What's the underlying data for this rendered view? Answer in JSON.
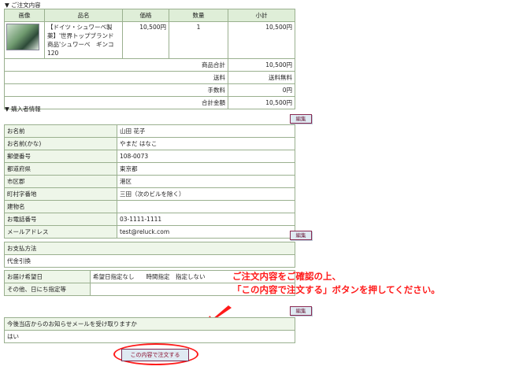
{
  "order": {
    "section_title": "▼ ご注文内容",
    "headers": [
      "画像",
      "品名",
      "価格",
      "数量",
      "小計"
    ],
    "item": {
      "name": "【ドイツ・シュワーベ製薬】'世界トップブランド商品'シュワーベ　ギンコ120",
      "price": "10,500円",
      "qty": "1",
      "subtotal": "10,500円"
    },
    "totals": [
      {
        "label": "商品合計",
        "value": "10,500円"
      },
      {
        "label": "送料",
        "value": "送料無料"
      },
      {
        "label": "手数料",
        "value": "0円"
      },
      {
        "label": "合計金額",
        "value": "10,500円"
      }
    ]
  },
  "buyer": {
    "section_title": "▼ 購入者情報",
    "edit_label": "編集",
    "rows": [
      {
        "label": "お名前",
        "value": "山田 花子"
      },
      {
        "label": "お名前(かな)",
        "value": "やまだ はなこ"
      },
      {
        "label": "郵便番号",
        "value": "108-0073"
      },
      {
        "label": "都道府県",
        "value": "東京都"
      },
      {
        "label": "市区郡",
        "value": "港区"
      },
      {
        "label": "町村字番地",
        "value": "三田（次のビルを除く）"
      },
      {
        "label": "建物名",
        "value": ""
      },
      {
        "label": "お電話番号",
        "value": "03-1111-1111"
      },
      {
        "label": "メールアドレス",
        "value": "test@reluck.com"
      }
    ]
  },
  "payment": {
    "edit_label": "編集",
    "label": "お支払方法",
    "value": "代金引換"
  },
  "delivery": {
    "rows": [
      {
        "label": "お届け希望日",
        "value": "希望日指定なし　　時間指定　指定しない"
      },
      {
        "label": "その他、日にち指定等",
        "value": ""
      }
    ]
  },
  "note": {
    "line1": "ご注文内容をご確認の上、",
    "line2": "「この内容で注文する」ボタンを押してください。"
  },
  "newsletter": {
    "edit_label": "編集",
    "label": "今後当店からのお知らせメールを受け取りますか",
    "value": "はい"
  },
  "submit_label": "この内容で注文する",
  "colors": {
    "header_bg": "#dfeed8",
    "border": "#9ab08f",
    "note_red": "#ff1a1a"
  }
}
